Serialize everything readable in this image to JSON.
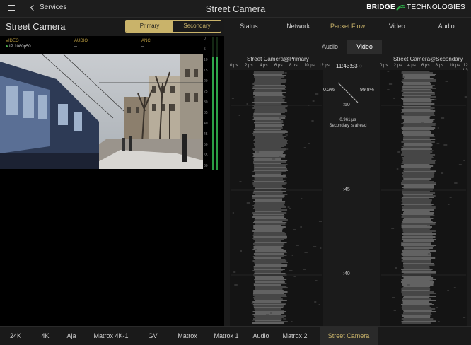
{
  "header": {
    "back_label": "Services",
    "title": "Street Camera",
    "logo_part1": "BRIDGE",
    "logo_part2": "TECHNOLOGIES"
  },
  "left_panel": {
    "title": "Street Camera",
    "source_toggle": {
      "primary": "Primary",
      "secondary": "Secondary",
      "selected": "Primary"
    },
    "video_label": "VIDEO",
    "video_value": "IP 1080p50",
    "audio_label": "AUDIO",
    "audio_value": "--",
    "anc_label": "ANC.",
    "anc_value": "--",
    "meter_scale": [
      "0",
      "5",
      "10",
      "15",
      "20",
      "25",
      "30",
      "35",
      "40",
      "45",
      "50",
      "55",
      "60"
    ]
  },
  "tabs": [
    "Status",
    "Network",
    "Packet Flow",
    "Video",
    "Audio"
  ],
  "selected_tab": "Packet Flow",
  "subtabs": [
    "Audio",
    "Video"
  ],
  "selected_subtab": "Video",
  "packet_flow": {
    "primary_title": "Street Camera@Primary",
    "secondary_title": "Street Camera@Secondary",
    "axis_labels": [
      "0 µs",
      "2 µs",
      "4 µs",
      "6 µs",
      "8 µs",
      "10 µs",
      "12 µs"
    ],
    "clock": "11:43:53",
    "primary_pct": "0.2%",
    "secondary_pct": "99.8%",
    "offset": "0.961 µs",
    "ahead_text": "Secondary is ahead",
    "time_marks": [
      ":50",
      ":45",
      ":40"
    ]
  },
  "bottom_tabs": [
    "24K",
    "4K",
    "Aja",
    "Matrox 4K-1",
    "GV",
    "Matrox",
    "Matrox 1",
    "Audio",
    "Matrox 2",
    "Street Camera"
  ],
  "selected_bottom_tab": "Street Camera",
  "colors": {
    "accent": "#c9b36a",
    "meter": "#2fa84a",
    "background": "#0e0e0e"
  }
}
